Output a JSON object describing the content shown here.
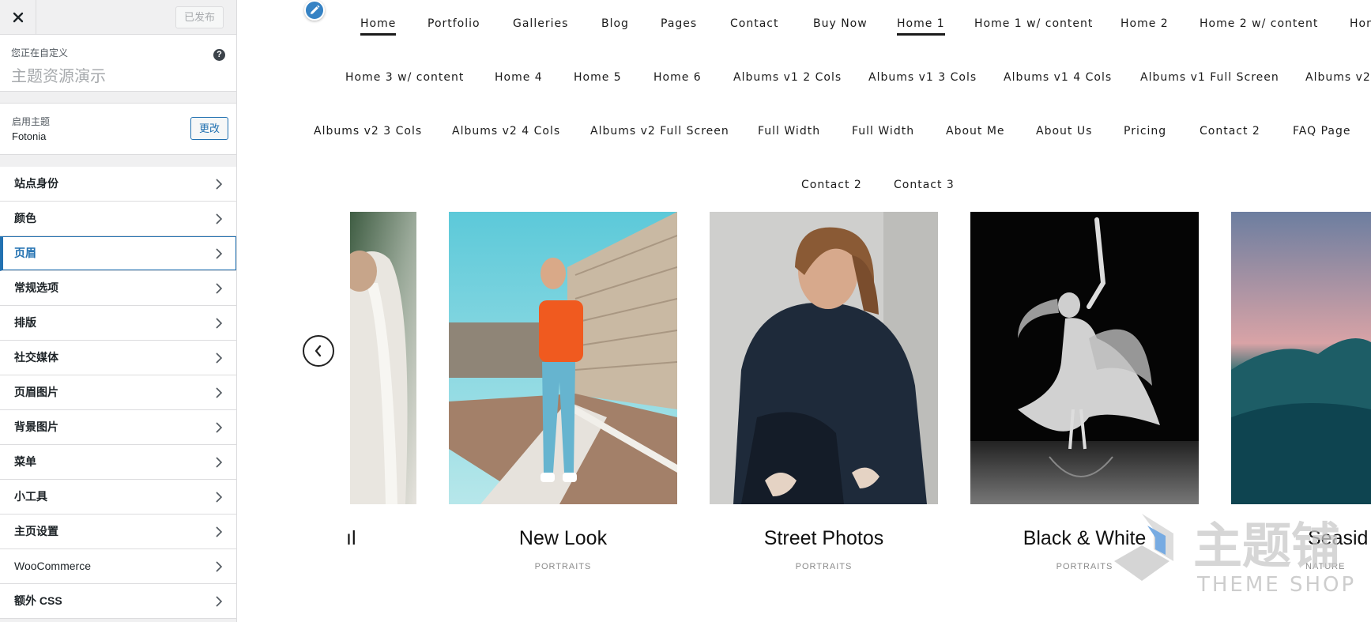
{
  "sidebar": {
    "publish_label": "已发布",
    "customizing_label": "您正在自定义",
    "site_title": "主题资源演示",
    "help_label": "?",
    "theme": {
      "label": "启用主题",
      "name": "Fotonia",
      "change_label": "更改"
    },
    "panels": [
      {
        "label": "站点身份"
      },
      {
        "label": "颜色"
      },
      {
        "label": "页眉",
        "active": true
      },
      {
        "label": "常规选项"
      },
      {
        "label": "排版"
      },
      {
        "label": "社交媒体"
      },
      {
        "label": "页眉图片"
      },
      {
        "label": "背景图片"
      },
      {
        "label": "菜单"
      },
      {
        "label": "小工具"
      },
      {
        "label": "主页设置"
      },
      {
        "label": "WooCommerce"
      },
      {
        "label": "额外 CSS"
      }
    ]
  },
  "preview": {
    "nav": [
      {
        "label": "Home",
        "current": true
      },
      {
        "label": "Portfolio"
      },
      {
        "label": "Galleries"
      },
      {
        "label": "Blog"
      },
      {
        "label": "Pages"
      },
      {
        "label": "Contact"
      },
      {
        "label": "Buy Now"
      },
      {
        "label": "Home 1",
        "current": true
      },
      {
        "label": "Home 1 w/ content"
      },
      {
        "label": "Home 2"
      },
      {
        "label": "Home 2 w/ content"
      },
      {
        "label": "Hon"
      },
      {
        "label": "Home 3 w/ content"
      },
      {
        "label": "Home 4"
      },
      {
        "label": "Home 5"
      },
      {
        "label": "Home 6"
      },
      {
        "label": "Albums v1 2 Cols"
      },
      {
        "label": "Albums v1 3 Cols"
      },
      {
        "label": "Albums v1 4 Cols"
      },
      {
        "label": "Albums v1 Full Screen"
      },
      {
        "label": "Albums v2"
      },
      {
        "label": "Albums v2 3 Cols"
      },
      {
        "label": "Albums v2 4 Cols"
      },
      {
        "label": "Albums v2 Full Screen"
      },
      {
        "label": "Full Width"
      },
      {
        "label": "Full Width"
      },
      {
        "label": "About Me"
      },
      {
        "label": "About Us"
      },
      {
        "label": "Pricing"
      },
      {
        "label": "Contact 2"
      },
      {
        "label": "FAQ Page"
      },
      {
        "label": "Contact 2"
      },
      {
        "label": "Contact 3"
      }
    ],
    "cards": [
      {
        "title": "ıl",
        "category": ""
      },
      {
        "title": "New Look",
        "category": "PORTRAITS"
      },
      {
        "title": "Street Photos",
        "category": "PORTRAITS"
      },
      {
        "title": "Black & White",
        "category": "PORTRAITS"
      },
      {
        "title": "Seasid",
        "category": "NATURE"
      }
    ]
  },
  "watermark": {
    "cn_text": "主题铺",
    "en_text": "THEME SHOP"
  },
  "colors": {
    "accent": "#2271b1",
    "sidebar_bg": "#f0f0f1",
    "edit_shortcut": "#3582c4"
  }
}
